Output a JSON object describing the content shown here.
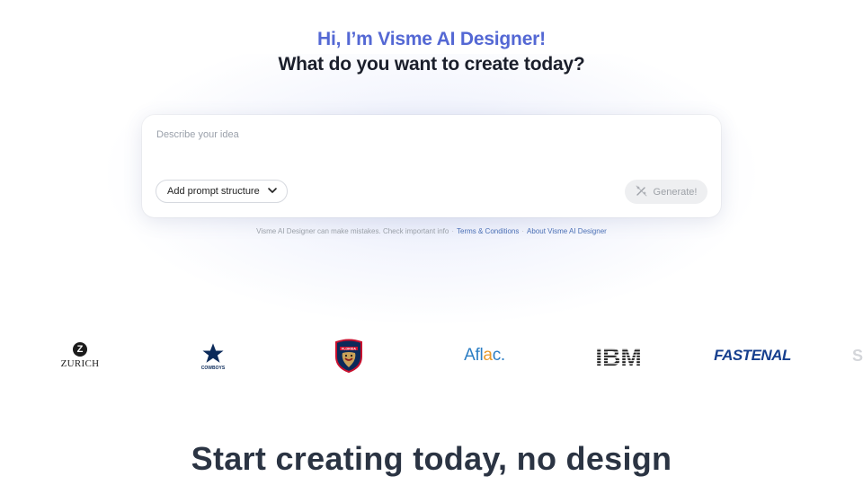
{
  "hero": {
    "title": "Hi, I’m Visme AI Designer!",
    "subtitle": "What do you want to create today?"
  },
  "prompt": {
    "placeholder": "Describe your idea",
    "value": "",
    "structure_label": "Add prompt structure",
    "generate_label": "Generate!"
  },
  "disclaimer": {
    "text": "Visme AI Designer can make mistakes. Check important info",
    "sep": "·",
    "terms_label": "Terms & Conditions",
    "about_label": "About Visme AI Designer"
  },
  "logos": {
    "zurich": "ZURICH",
    "cowboys": "COWBOYS",
    "panthers": "FLORIDA",
    "aflac_pre": "Afl",
    "aflac_mid": "a",
    "aflac_post": "c.",
    "ibm": "IBM",
    "fastenal": "FASTENAL",
    "partial": "S"
  },
  "footer": {
    "heading": "Start creating today, no design"
  },
  "colors": {
    "accent": "#5468d4",
    "heading": "#1b1f2b",
    "link": "#4a6fb5"
  }
}
